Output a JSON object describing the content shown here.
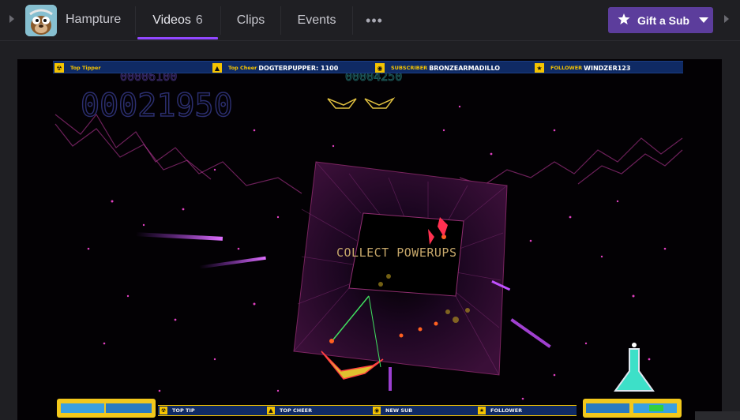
{
  "nav": {
    "channel_name": "Hampture",
    "tabs": [
      {
        "label": "Videos",
        "count": "6"
      },
      {
        "label": "Clips"
      },
      {
        "label": "Events"
      }
    ],
    "more_label": "•••",
    "gift_button": "Gift a Sub",
    "accent_color": "#9147ff",
    "gift_color": "#5c3d9c"
  },
  "stream_overlay": {
    "top_alerts": [
      {
        "label": "Top Tipper",
        "value": ""
      },
      {
        "label": "Top Cheer",
        "value": "DOGTERPUPPER: 1100"
      },
      {
        "label": "SUBSCRIBER",
        "value": "BRONZEARMADILLO"
      },
      {
        "label": "FOLLOWER",
        "value": "WINDZER123"
      }
    ],
    "bottom_alerts": [
      {
        "label": "TOP TIP"
      },
      {
        "label": "TOP CHEER"
      },
      {
        "label": "NEW SUB"
      },
      {
        "label": "FOLLOWER"
      }
    ],
    "game": {
      "score": "00021950",
      "small_score_left": "00006100",
      "small_score_right": "00004250",
      "message": "COLLECT POWERUPS"
    }
  }
}
